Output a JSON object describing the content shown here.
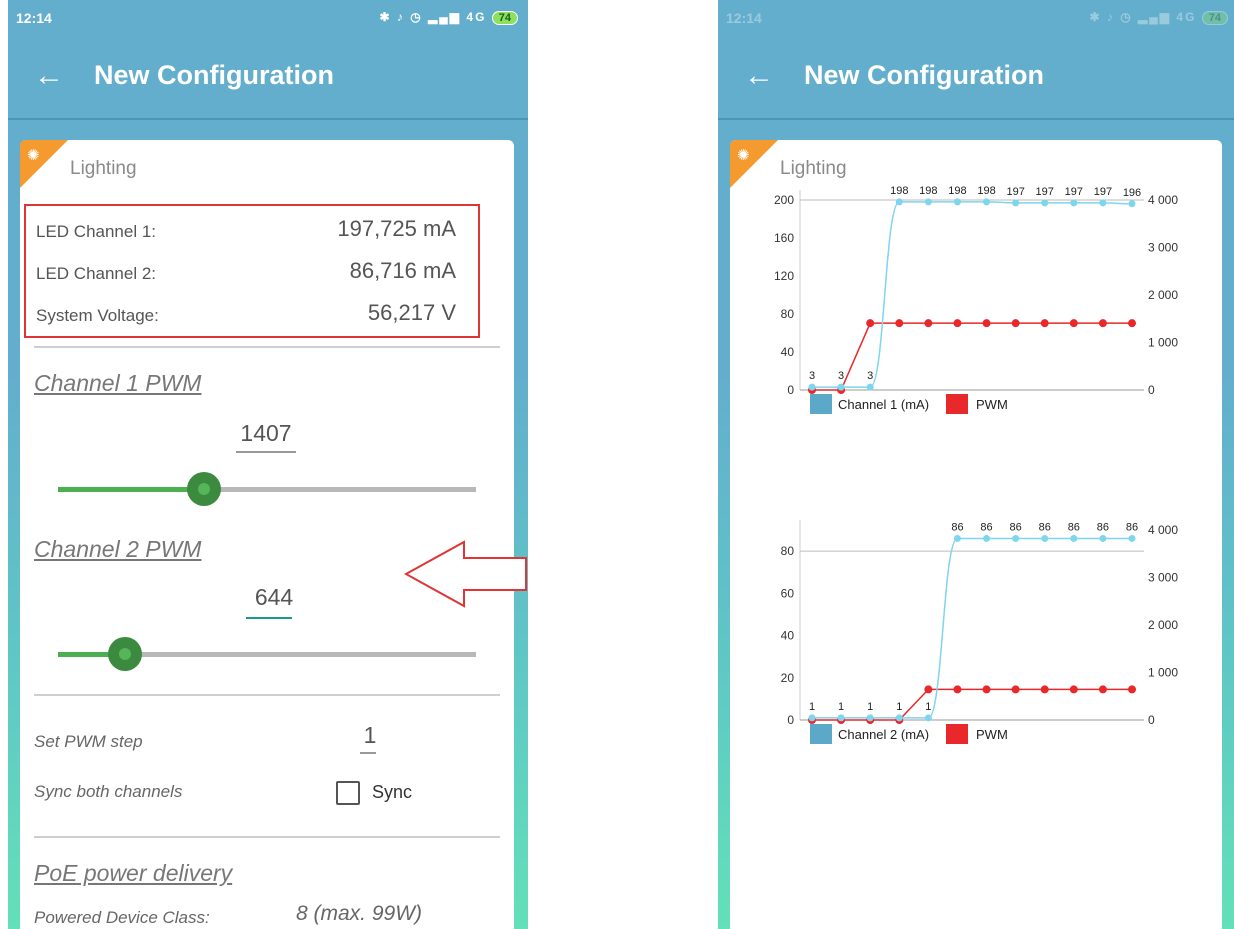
{
  "status": {
    "time": "12:14",
    "battery": "74",
    "battery_right": "74",
    "network": "4G"
  },
  "appbar": {
    "title": "New Configuration"
  },
  "card": {
    "title": "Lighting"
  },
  "measurements": [
    {
      "label": "LED Channel 1:",
      "value": "197,725 mA"
    },
    {
      "label": "LED Channel 2:",
      "value": "86,716 mA"
    },
    {
      "label": "System Voltage:",
      "value": "56,217 V"
    }
  ],
  "channel1": {
    "heading": "Channel 1 PWM",
    "value": "1407",
    "slider_fraction": 0.35
  },
  "channel2": {
    "heading": "Channel 2 PWM",
    "value": "644",
    "slider_fraction": 0.16
  },
  "settings": {
    "step_label": "Set PWM step",
    "step_value": "1",
    "sync_label": "Sync both channels",
    "sync_checkbox_label": "Sync",
    "sync_checked": false
  },
  "poe": {
    "heading": "PoE power delivery",
    "class_label": "Powered Device Class:",
    "class_value": "8 (max. 99W)"
  },
  "colors": {
    "appbar": "#63aecd",
    "accent_green": "#4caf50",
    "highlight_red": "#e03535",
    "corner_orange": "#f59a2e",
    "series_current": "#7fd4ee",
    "series_pwm": "#e8282a",
    "legend_current": "#5ba8c8"
  },
  "chart_data": [
    {
      "type": "line",
      "x": [
        1,
        2,
        3,
        4,
        5,
        6,
        7,
        8,
        9,
        10,
        11,
        12
      ],
      "y_left_ticks": [
        "0",
        "40",
        "80",
        "120",
        "160",
        "200"
      ],
      "y_right_ticks": [
        "0",
        "1 000",
        "2 000",
        "3 000",
        "4 000"
      ],
      "ylim_left": [
        0,
        200
      ],
      "ylim_right": [
        0,
        4000
      ],
      "series": [
        {
          "name": "Channel 1 (mA)",
          "axis": "left",
          "values": [
            3,
            3,
            3,
            198,
            198,
            198,
            198,
            197,
            197,
            197,
            197,
            196
          ],
          "data_labels": [
            "3",
            "3",
            "3",
            "198",
            "198",
            "198",
            "198",
            "197",
            "197",
            "197",
            "197",
            "196"
          ]
        },
        {
          "name": "PWM",
          "axis": "right",
          "values": [
            0,
            0,
            1407,
            1407,
            1407,
            1407,
            1407,
            1407,
            1407,
            1407,
            1407,
            1407
          ]
        }
      ],
      "legend": [
        "Channel 1 (mA)",
        "PWM"
      ],
      "legend_position": "bottom-left",
      "grid": false
    },
    {
      "type": "line",
      "x": [
        1,
        2,
        3,
        4,
        5,
        6,
        7,
        8,
        9,
        10,
        11,
        12
      ],
      "y_left_ticks": [
        "0",
        "20",
        "40",
        "60",
        "80"
      ],
      "y_right_ticks": [
        "0",
        "1 000",
        "2 000",
        "3 000",
        "4 000"
      ],
      "ylim_left": [
        0,
        90
      ],
      "ylim_right": [
        0,
        4000
      ],
      "series": [
        {
          "name": "Channel 2 (mA)",
          "axis": "left",
          "values": [
            1,
            1,
            1,
            1,
            1,
            86,
            86,
            86,
            86,
            86,
            86,
            86
          ],
          "data_labels": [
            "1",
            "1",
            "1",
            "1",
            "1",
            "86",
            "86",
            "86",
            "86",
            "86",
            "86",
            "86"
          ]
        },
        {
          "name": "PWM",
          "axis": "right",
          "values": [
            0,
            0,
            0,
            0,
            644,
            644,
            644,
            644,
            644,
            644,
            644,
            644
          ]
        }
      ],
      "legend": [
        "Channel 2 (mA)",
        "PWM"
      ],
      "legend_position": "bottom-left",
      "grid": false
    }
  ]
}
